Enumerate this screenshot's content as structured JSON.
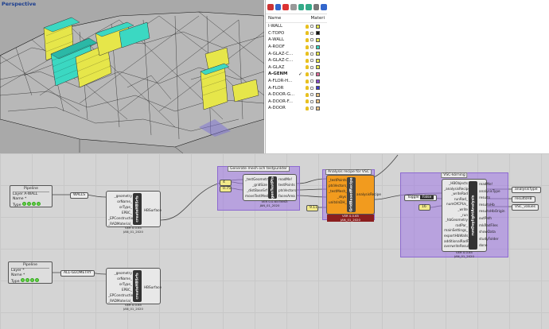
{
  "viewport": {
    "title": "Perspective"
  },
  "layers": {
    "header": {
      "name": "Name",
      "material": "Materi"
    },
    "items": [
      {
        "name": "I-WALL",
        "color": "#e6e64a",
        "current": false
      },
      {
        "name": "C-TOPO",
        "color": "#111111",
        "current": false
      },
      {
        "name": "A-WALL",
        "color": "#e6e64a",
        "current": false
      },
      {
        "name": "A-ROOF",
        "color": "#3bd8c2",
        "current": false
      },
      {
        "name": "A-GLAZ-C...",
        "color": "#e6e64a",
        "current": false
      },
      {
        "name": "A-GLAZ-C...",
        "color": "#e6e64a",
        "current": false
      },
      {
        "name": "A-GLAZ",
        "color": "#e6e64a",
        "current": false
      },
      {
        "name": "A-GENM",
        "color": "#e46a9a",
        "current": true
      },
      {
        "name": "A-FLOR-H...",
        "color": "#8a4bd0",
        "current": false
      },
      {
        "name": "A-FLOR",
        "color": "#3a3acc",
        "current": false
      },
      {
        "name": "A-DOOR-G...",
        "color": "#e8c080",
        "current": false
      },
      {
        "name": "A-DOOR-F...",
        "color": "#e8c080",
        "current": false
      },
      {
        "name": "A-DOOR",
        "color": "#e8c080",
        "current": false
      }
    ],
    "check_glyph": "✓"
  },
  "canvas": {
    "pipeline1": {
      "title": "Pipeline",
      "layer": "Layer  A-WALL",
      "name": "Name  *",
      "type": "Type"
    },
    "relay1": "WALLS",
    "pipeline2": {
      "title": "Pipeline",
      "layer": "Layer  *",
      "name": "Name  *",
      "type": "Type"
    },
    "relay2": "ALL-GEOMETRY",
    "comp1": {
      "inputs": [
        "_geometry",
        "orName_",
        "orType_",
        "EPBC_",
        "_EPConstruction_",
        "_RADMaterial_"
      ],
      "outputs": [
        "HBSurface"
      ],
      "label": "createHBSrfs",
      "version": "VER 0.0.65\nJAN_01_2020"
    },
    "comp2": {
      "inputs": [
        "_geometry",
        "orName_",
        "orType_",
        "EPBC_",
        "_EPConstruction_",
        "_RADMaterial_"
      ],
      "outputs": [
        "HBSurface"
      ],
      "label": "createHBSrfs",
      "version": "VER 0.0.65\nJAN_01_2020"
    },
    "group1": {
      "title": "Generate mesh och testpunkter"
    },
    "gen_inputs": [
      "4",
      "0.75"
    ],
    "comp3": {
      "inputs": [
        "_testGeometry",
        "_gridSize",
        "_distBaseSrf",
        "moveTestMesh_"
      ],
      "outputs": [
        "readMe!",
        "testPoints",
        "ptsVectors",
        "facesArea",
        "mesh"
      ],
      "label": "genTestPts",
      "version": "VER 0.0.65\nJAN_01_2020"
    },
    "group2": {
      "title": "Analysis recipe för VSC"
    },
    "comp4": {
      "inputs": [
        "_testPoints",
        "ptsVectors_",
        "_testMesh_",
        "_skys",
        "unitsInDH_"
      ],
      "outputs": [
        "analysisRecipe"
      ],
      "label": "GridBasedRecipe",
      "version": "VER 0.0.65\nJAN_01_2020"
    },
    "val_9": "9.11",
    "group3": {
      "title": "VSC-körning"
    },
    "toggle": {
      "label": "Toggle",
      "value": "False"
    },
    "num_16": "16",
    "comp5": {
      "inputs": [
        "_HBObjects",
        "_analysisRecipe",
        "_writeRad",
        "runRad_",
        "numOfCPUs_",
        "_write",
        "_run",
        "_hbGeometry",
        "radPar_",
        "mainSettings_",
        "exportHbWalls_",
        "additionalRadFiles_",
        "overwriteResults_"
      ],
      "outputs": [
        "readMe!",
        "analysisType",
        "results",
        "resultsHb",
        "resultsHbOrigin",
        "outPath",
        "mkRadFiles",
        "showData",
        "studyFolder",
        "done"
      ],
      "label": "runDaylightAnalysis",
      "version": "VER 0.0.65\nJAN_01_2020"
    },
    "out_labels": [
      "analysisType",
      "resultsHB",
      "VSC_values"
    ]
  }
}
